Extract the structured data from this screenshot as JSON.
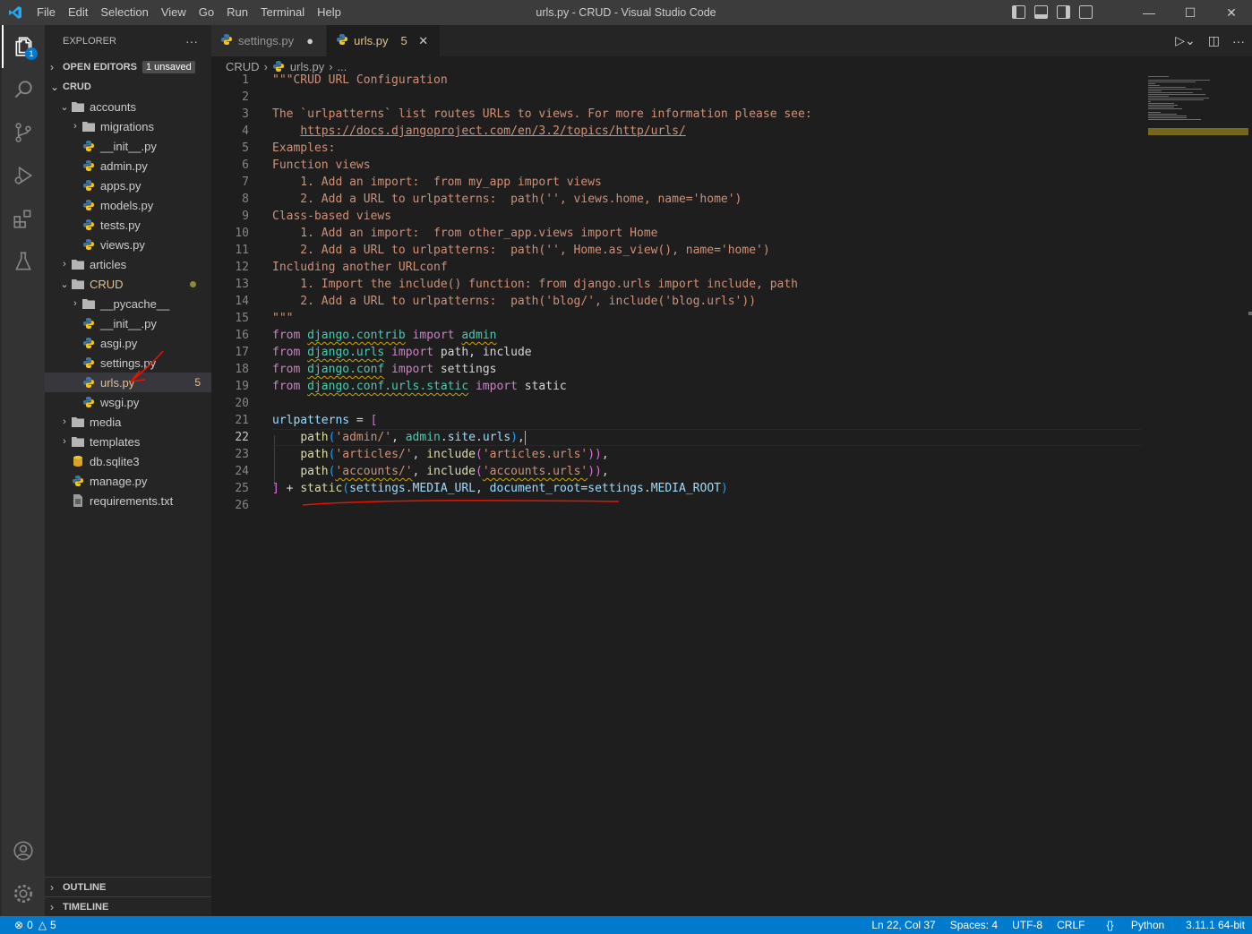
{
  "window": {
    "title": "urls.py - CRUD - Visual Studio Code",
    "menu": [
      "File",
      "Edit",
      "Selection",
      "View",
      "Go",
      "Run",
      "Terminal",
      "Help"
    ]
  },
  "activity": {
    "explorer_badge": "1"
  },
  "sidebar": {
    "title": "EXPLORER",
    "more": "···",
    "open_editors": {
      "label": "OPEN EDITORS",
      "badge": "1 unsaved"
    },
    "root": "CRUD",
    "tree": [
      {
        "label": "accounts",
        "type": "folder",
        "depth": 1,
        "open": true
      },
      {
        "label": "migrations",
        "type": "folder",
        "depth": 2,
        "open": false
      },
      {
        "label": "__init__.py",
        "type": "py",
        "depth": 2
      },
      {
        "label": "admin.py",
        "type": "py",
        "depth": 2
      },
      {
        "label": "apps.py",
        "type": "py",
        "depth": 2
      },
      {
        "label": "models.py",
        "type": "py",
        "depth": 2
      },
      {
        "label": "tests.py",
        "type": "py",
        "depth": 2
      },
      {
        "label": "views.py",
        "type": "py",
        "depth": 2
      },
      {
        "label": "articles",
        "type": "folder",
        "depth": 1,
        "open": false
      },
      {
        "label": "CRUD",
        "type": "folder",
        "depth": 1,
        "open": true,
        "modified": true
      },
      {
        "label": "__pycache__",
        "type": "folder",
        "depth": 2,
        "open": false
      },
      {
        "label": "__init__.py",
        "type": "py",
        "depth": 2
      },
      {
        "label": "asgi.py",
        "type": "py",
        "depth": 2
      },
      {
        "label": "settings.py",
        "type": "py",
        "depth": 2
      },
      {
        "label": "urls.py",
        "type": "py",
        "depth": 2,
        "selected": true,
        "problems": "5"
      },
      {
        "label": "wsgi.py",
        "type": "py",
        "depth": 2
      },
      {
        "label": "media",
        "type": "folder",
        "depth": 1,
        "open": false
      },
      {
        "label": "templates",
        "type": "folder",
        "depth": 1,
        "open": false
      },
      {
        "label": "db.sqlite3",
        "type": "db",
        "depth": 1
      },
      {
        "label": "manage.py",
        "type": "py",
        "depth": 1
      },
      {
        "label": "requirements.txt",
        "type": "txt",
        "depth": 1
      }
    ],
    "outline": "OUTLINE",
    "timeline": "TIMELINE"
  },
  "tabs": [
    {
      "label": "settings.py",
      "active": false,
      "dirty": true
    },
    {
      "label": "urls.py",
      "active": true,
      "problems": "5"
    }
  ],
  "breadcrumb": [
    "CRUD",
    "urls.py",
    "..."
  ],
  "editor": {
    "current_line": 22,
    "lines": [
      [
        [
          "str",
          "\"\"\"CRUD URL Configuration"
        ]
      ],
      [],
      [
        [
          "str",
          "The `urlpatterns` list routes URLs to views. For more information please see:"
        ]
      ],
      [
        [
          "str",
          "    "
        ],
        [
          "strlink",
          "https://docs.djangoproject.com/en/3.2/topics/http/urls/"
        ]
      ],
      [
        [
          "str",
          "Examples:"
        ]
      ],
      [
        [
          "str",
          "Function views"
        ]
      ],
      [
        [
          "str",
          "    1. Add an import:  from my_app import views"
        ]
      ],
      [
        [
          "str",
          "    2. Add a URL to urlpatterns:  path('', views.home, name='home')"
        ]
      ],
      [
        [
          "str",
          "Class-based views"
        ]
      ],
      [
        [
          "str",
          "    1. Add an import:  from other_app.views import Home"
        ]
      ],
      [
        [
          "str",
          "    2. Add a URL to urlpatterns:  path('', Home.as_view(), name='home')"
        ]
      ],
      [
        [
          "str",
          "Including another URLconf"
        ]
      ],
      [
        [
          "str",
          "    1. Import the include() function: from django.urls import include, path"
        ]
      ],
      [
        [
          "str",
          "    2. Add a URL to urlpatterns:  path('blog/', include('blog.urls'))"
        ]
      ],
      [
        [
          "str",
          "\"\"\""
        ]
      ],
      [
        [
          "kw",
          "from "
        ],
        [
          "modsq",
          "django.contrib"
        ],
        [
          "kw",
          " import "
        ],
        [
          "modsq",
          "admin"
        ]
      ],
      [
        [
          "kw",
          "from "
        ],
        [
          "modsq",
          "django.urls"
        ],
        [
          "kw",
          " import "
        ],
        [
          "plain",
          "path, include"
        ]
      ],
      [
        [
          "kw",
          "from "
        ],
        [
          "modsq",
          "django.conf"
        ],
        [
          "kw",
          " import "
        ],
        [
          "plain",
          "settings"
        ]
      ],
      [
        [
          "kw",
          "from "
        ],
        [
          "modsq",
          "django.conf.urls.static"
        ],
        [
          "kw",
          " import "
        ],
        [
          "plain",
          "static"
        ]
      ],
      [],
      [
        [
          "var",
          "urlpatterns"
        ],
        [
          "plain",
          " = "
        ],
        [
          "br",
          "["
        ]
      ],
      [
        [
          "plain",
          "    "
        ],
        [
          "fn",
          "path"
        ],
        [
          "br2",
          "("
        ],
        [
          "str",
          "'admin/'"
        ],
        [
          "plain",
          ", "
        ],
        [
          "mod",
          "admin"
        ],
        [
          "plain",
          "."
        ],
        [
          "var",
          "site"
        ],
        [
          "plain",
          "."
        ],
        [
          "var",
          "urls"
        ],
        [
          "br2",
          ")"
        ],
        [
          "plain",
          ","
        ]
      ],
      [
        [
          "plain",
          "    "
        ],
        [
          "fn",
          "path"
        ],
        [
          "br2",
          "("
        ],
        [
          "str",
          "'articles/'"
        ],
        [
          "plain",
          ", "
        ],
        [
          "fn",
          "include"
        ],
        [
          "br",
          "("
        ],
        [
          "str",
          "'articles.urls'"
        ],
        [
          "br",
          "))"
        ],
        [
          "plain",
          ","
        ]
      ],
      [
        [
          "plain",
          "    "
        ],
        [
          "fn",
          "path"
        ],
        [
          "br2",
          "("
        ],
        [
          "strsq",
          "'accounts/'"
        ],
        [
          "plain",
          ", "
        ],
        [
          "fn",
          "include"
        ],
        [
          "br",
          "("
        ],
        [
          "strsq",
          "'accounts.urls'"
        ],
        [
          "br",
          "))"
        ],
        [
          "plain",
          ","
        ]
      ],
      [
        [
          "br",
          "]"
        ],
        [
          "plain",
          " + "
        ],
        [
          "fn",
          "static"
        ],
        [
          "br2",
          "("
        ],
        [
          "var",
          "settings"
        ],
        [
          "plain",
          "."
        ],
        [
          "var",
          "MEDIA_URL"
        ],
        [
          "plain",
          ", "
        ],
        [
          "var",
          "document_root"
        ],
        [
          "plain",
          "="
        ],
        [
          "var",
          "settings"
        ],
        [
          "plain",
          "."
        ],
        [
          "var",
          "MEDIA_ROOT"
        ],
        [
          "br2",
          ")"
        ]
      ],
      []
    ]
  },
  "status": {
    "errors": "0",
    "warnings": "5",
    "position": "Ln 22, Col 37",
    "spaces": "Spaces: 4",
    "encoding": "UTF-8",
    "eol": "CRLF",
    "language": "Python",
    "interpreter": "3.11.1 64-bit"
  },
  "colors": {
    "accent": "#007acc",
    "modified": "#e2c08d",
    "annotation": "#e51400"
  }
}
